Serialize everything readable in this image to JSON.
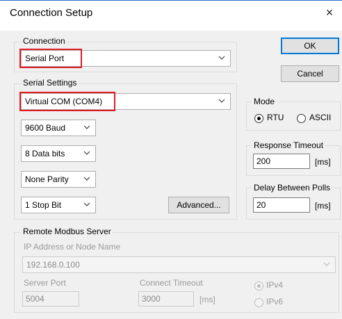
{
  "window": {
    "title": "Connection Setup",
    "close_symbol": "×"
  },
  "buttons": {
    "ok": "OK",
    "cancel": "Cancel",
    "advanced": "Advanced..."
  },
  "connection": {
    "group_label": "Connection",
    "type_value": "Serial Port"
  },
  "serial_settings": {
    "group_label": "Serial Settings",
    "port_value": "Virtual COM (COM4)",
    "baud_value": "9600 Baud",
    "data_bits_value": "8 Data bits",
    "parity_value": "None Parity",
    "stop_bits_value": "1 Stop Bit"
  },
  "mode": {
    "group_label": "Mode",
    "options": [
      {
        "label": "RTU",
        "selected": true
      },
      {
        "label": "ASCII",
        "selected": false
      }
    ]
  },
  "response_timeout": {
    "group_label": "Response Timeout",
    "value": "200",
    "unit": "[ms]"
  },
  "delay_between_polls": {
    "group_label": "Delay Between Polls",
    "value": "20",
    "unit": "[ms]"
  },
  "remote_server": {
    "group_label": "Remote Modbus Server",
    "address_label": "IP Address or Node Name",
    "address_value": "192.168.0.100",
    "server_port_label": "Server Port",
    "server_port_value": "5004",
    "connect_timeout_label": "Connect Timeout",
    "connect_timeout_value": "3000",
    "connect_timeout_unit": "[ms]",
    "ip_options": [
      {
        "label": "IPv4",
        "selected": true
      },
      {
        "label": "IPv6",
        "selected": false
      }
    ]
  },
  "colors": {
    "highlight": "#e01b24",
    "accent": "#0078d7",
    "dialog_bg": "#f0f0f0"
  },
  "icons": {
    "dropdown": "chevron-down-icon",
    "close": "close-icon"
  }
}
